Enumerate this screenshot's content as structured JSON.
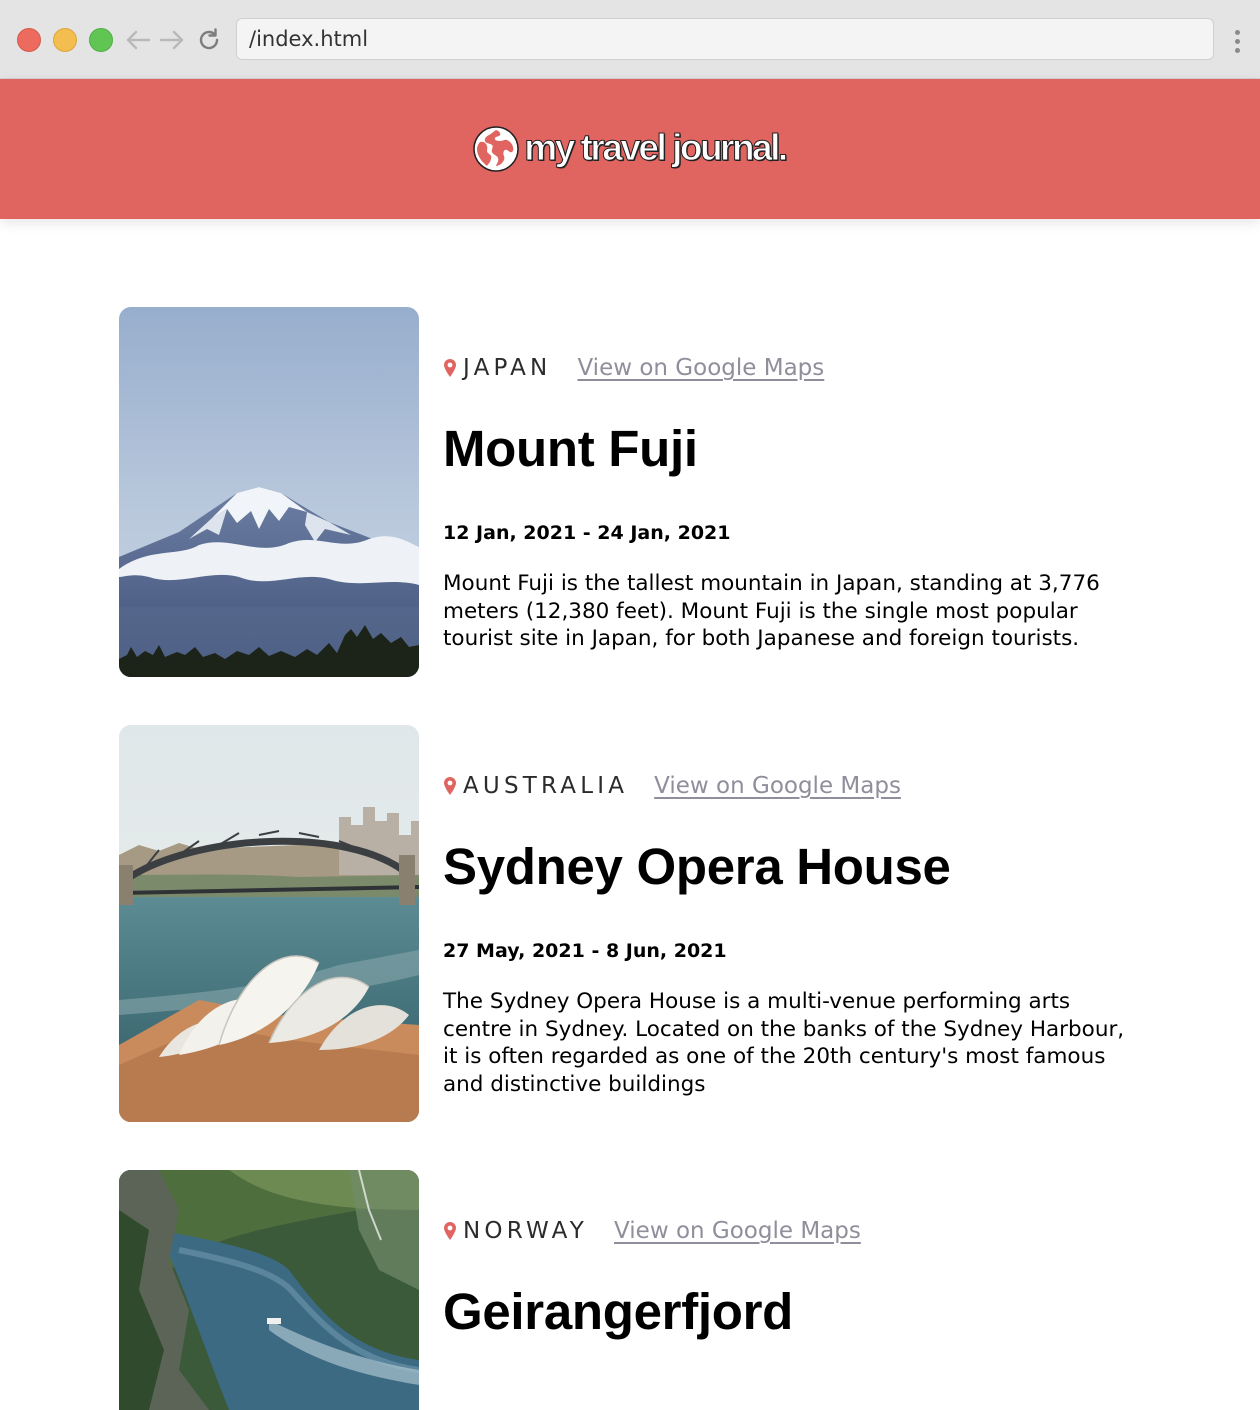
{
  "browser": {
    "address": "/index.html"
  },
  "header": {
    "brand_icon": "globe-icon",
    "brand_text": "my travel journal."
  },
  "entries": [
    {
      "country": "JAPAN",
      "maps_link": "View on Google Maps",
      "title": "Mount Fuji",
      "dates": "12 Jan, 2021 - 24 Jan, 2021",
      "description": "Mount Fuji is the tallest mountain in Japan, standing at 3,776 meters (12,380 feet). Mount Fuji is the single most popular tourist site in Japan, for both Japanese and foreign tourists.",
      "photo": "mount-fuji-photo"
    },
    {
      "country": "AUSTRALIA",
      "maps_link": "View on Google Maps",
      "title": "Sydney Opera House",
      "dates": "27 May, 2021 - 8 Jun, 2021",
      "description": "The Sydney Opera House is a multi-venue performing arts centre in Sydney. Located on the banks of the Sydney Harbour, it is often regarded as one of the 20th century's most famous and distinctive buildings",
      "photo": "sydney-opera-house-photo"
    },
    {
      "country": "NORWAY",
      "maps_link": "View on Google Maps",
      "title": "Geirangerfjord",
      "photo": "geirangerfjord-photo"
    }
  ],
  "colors": {
    "header_bg": "#e06561",
    "pin": "#e06561",
    "link": "#918e9b"
  }
}
